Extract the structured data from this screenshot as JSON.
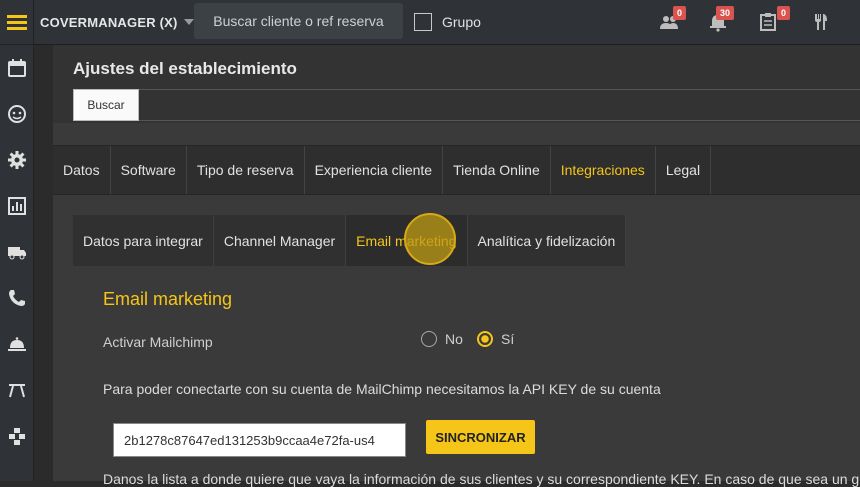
{
  "topbar": {
    "brand": "COVERMANAGER (X)",
    "search_placeholder": "Buscar cliente o ref reserva",
    "grupo_label": "Grupo",
    "badges": {
      "people": "0",
      "bell": "30",
      "calendar": "0"
    }
  },
  "colors": {
    "accent": "#f5c518",
    "sidebar": "#2f3337",
    "danger": "#d9534f"
  },
  "sidebar": {
    "items": [
      "menu-icon",
      "calendar-icon",
      "face-icon",
      "gear-icon",
      "chart-icon",
      "truck-icon",
      "phone-icon",
      "cloche-icon",
      "table-icon",
      "network-icon"
    ]
  },
  "page": {
    "title": "Ajustes del establecimiento",
    "buscar": "Buscar"
  },
  "tabs": [
    "Datos",
    "Software",
    "Tipo de reserva",
    "Experiencia cliente",
    "Tienda Online",
    "Integraciones",
    "Legal"
  ],
  "active_tab": "Integraciones",
  "subtabs": [
    "Datos para integrar",
    "Channel Manager",
    "Email marketing",
    "Analítica y fidelización"
  ],
  "active_subtab": "Email marketing",
  "email": {
    "section_title": "Email marketing",
    "activar_label": "Activar Mailchimp",
    "no": "No",
    "si": "Sí",
    "selected": "Sí",
    "description": "Para poder conectarte con su cuenta de MailChimp necesitamos la API KEY de su cuenta",
    "api_key": "2b1278c87647ed131253b9ccaa4e72fa-us4",
    "sync_button": "SINCRONIZAR",
    "description2": "Danos la lista a donde quiere que vaya la información de sus clientes y su correspondiente KEY. En caso de que sea un gr"
  }
}
